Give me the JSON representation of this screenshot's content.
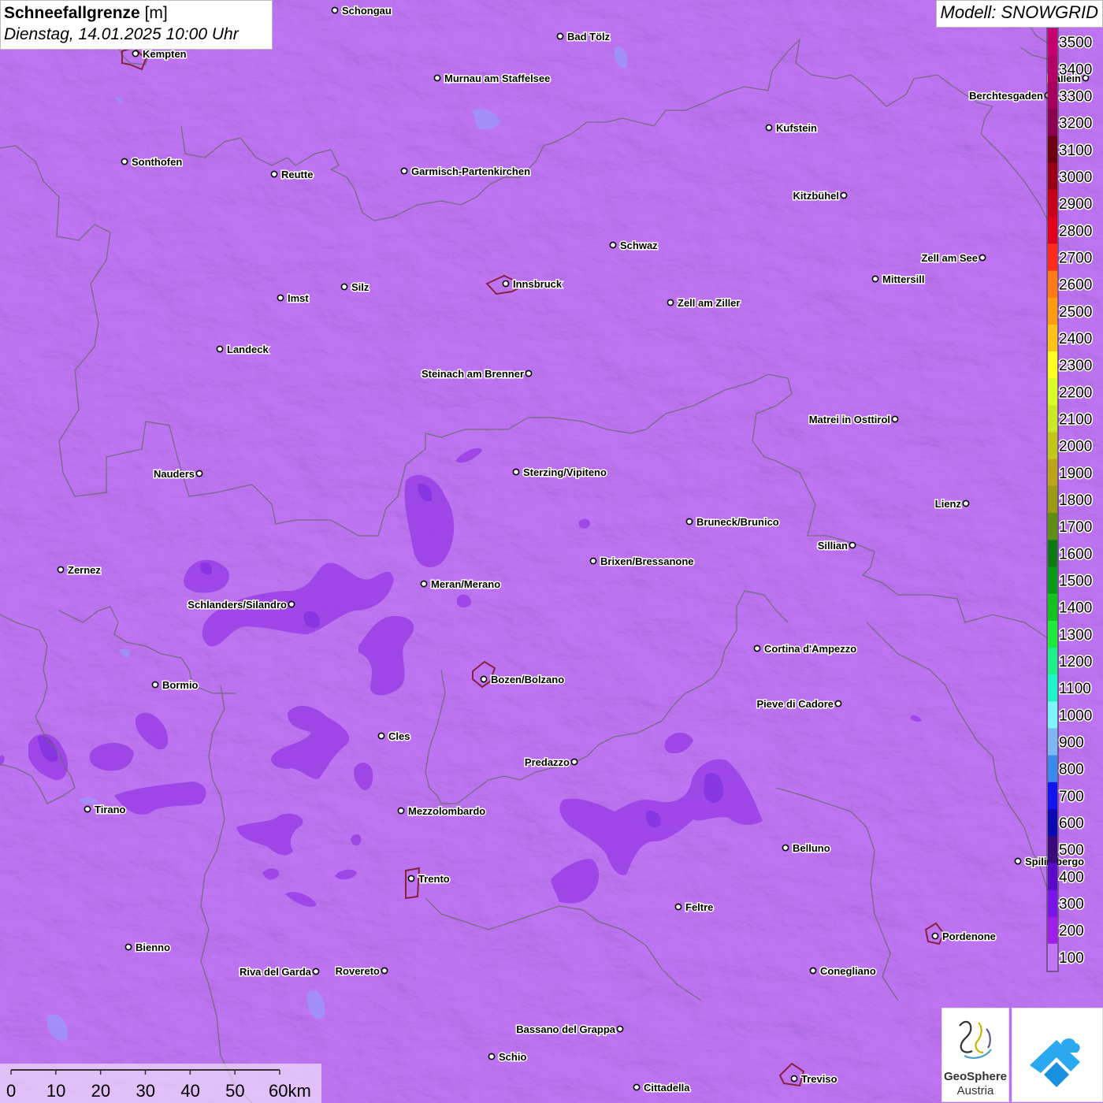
{
  "header": {
    "title_bold": "Schneefallgrenze",
    "title_unit": "[m]",
    "datetime": "Dienstag, 14.01.2025 10:00 Uhr",
    "model": "Modell: SNOWGRID"
  },
  "colors": {
    "background": "#c277f7",
    "snow_zone_dark": "#9a3fe6",
    "snow_zone_core": "#7b2be0",
    "border_line": "#666666",
    "city_outline": "#8a2040"
  },
  "legend": {
    "levels": [
      {
        "label": "3500",
        "color": "#c6006f"
      },
      {
        "label": "3400",
        "color": "#b40066"
      },
      {
        "label": "3300",
        "color": "#a5005f"
      },
      {
        "label": "3200",
        "color": "#8b0050"
      },
      {
        "label": "3100",
        "color": "#6e0014"
      },
      {
        "label": "3000",
        "color": "#9b0014"
      },
      {
        "label": "2900",
        "color": "#c8001a"
      },
      {
        "label": "2800",
        "color": "#e0001c"
      },
      {
        "label": "2700",
        "color": "#ff2a1c"
      },
      {
        "label": "2600",
        "color": "#ff7a14"
      },
      {
        "label": "2500",
        "color": "#ff9a12"
      },
      {
        "label": "2400",
        "color": "#ffc21a"
      },
      {
        "label": "2300",
        "color": "#ffff22"
      },
      {
        "label": "2200",
        "color": "#d9ff25"
      },
      {
        "label": "2100",
        "color": "#c8e828"
      },
      {
        "label": "2000",
        "color": "#c2c61a"
      },
      {
        "label": "1900",
        "color": "#bca41a"
      },
      {
        "label": "1800",
        "color": "#9a9a14"
      },
      {
        "label": "1700",
        "color": "#5e8e14"
      },
      {
        "label": "1600",
        "color": "#0b7a14"
      },
      {
        "label": "1500",
        "color": "#0a9a1a"
      },
      {
        "label": "1400",
        "color": "#14c41e"
      },
      {
        "label": "1300",
        "color": "#1ee83a"
      },
      {
        "label": "1200",
        "color": "#1ef08c"
      },
      {
        "label": "1100",
        "color": "#22f2c8"
      },
      {
        "label": "1000",
        "color": "#7ef6f8"
      },
      {
        "label": "900",
        "color": "#7eb6f6"
      },
      {
        "label": "800",
        "color": "#3a8aee"
      },
      {
        "label": "700",
        "color": "#1414ee"
      },
      {
        "label": "600",
        "color": "#0a0ab4"
      },
      {
        "label": "500",
        "color": "#3a0a7a"
      },
      {
        "label": "400",
        "color": "#5a0ac8"
      },
      {
        "label": "300",
        "color": "#7a14e8"
      },
      {
        "label": "200",
        "color": "#a01ee8"
      },
      {
        "label": "100",
        "color": "#c277f7"
      }
    ]
  },
  "cities": [
    {
      "name": "Schongau"
    },
    {
      "name": "Bad Tölz"
    },
    {
      "name": "Kempten"
    },
    {
      "name": "Murnau am Staffelsee"
    },
    {
      "name": "Berchtesgaden"
    },
    {
      "name": "Hallein"
    },
    {
      "name": "Kufstein"
    },
    {
      "name": "Sonthofen"
    },
    {
      "name": "Reutte"
    },
    {
      "name": "Garmisch-Partenkirchen"
    },
    {
      "name": "Kitzbühel"
    },
    {
      "name": "Schwaz"
    },
    {
      "name": "Zell am See"
    },
    {
      "name": "Mittersill"
    },
    {
      "name": "Innsbruck"
    },
    {
      "name": "Silz"
    },
    {
      "name": "Imst"
    },
    {
      "name": "Zell am Ziller"
    },
    {
      "name": "Landeck"
    },
    {
      "name": "Steinach am Brenner"
    },
    {
      "name": "Matrei in Osttirol"
    },
    {
      "name": "Nauders"
    },
    {
      "name": "Sterzing/Vipiteno"
    },
    {
      "name": "Lienz"
    },
    {
      "name": "Bruneck/Brunico"
    },
    {
      "name": "Sillian"
    },
    {
      "name": "Brixen/Bressanone"
    },
    {
      "name": "Zernez"
    },
    {
      "name": "Meran/Merano"
    },
    {
      "name": "Schlanders/Silandro"
    },
    {
      "name": "Cortina d'Ampezzo"
    },
    {
      "name": "Bozen/Bolzano"
    },
    {
      "name": "Bormio"
    },
    {
      "name": "Pieve di Cadore"
    },
    {
      "name": "Cles"
    },
    {
      "name": "Predazzo"
    },
    {
      "name": "Tirano"
    },
    {
      "name": "Mezzolombardo"
    },
    {
      "name": "Belluno"
    },
    {
      "name": "Spilimbergo"
    },
    {
      "name": "Trento"
    },
    {
      "name": "Feltre"
    },
    {
      "name": "Pordenone"
    },
    {
      "name": "Bienno"
    },
    {
      "name": "Riva del Garda"
    },
    {
      "name": "Rovereto"
    },
    {
      "name": "Conegliano"
    },
    {
      "name": "Bassano del Grappa"
    },
    {
      "name": "Schio"
    },
    {
      "name": "Treviso"
    },
    {
      "name": "Cittadella"
    }
  ],
  "scale_bar": {
    "ticks": [
      "0",
      "10",
      "20",
      "30",
      "40",
      "50",
      "60km"
    ]
  },
  "logos": {
    "geosphere_line1": "GeoSphere",
    "geosphere_line2": "Austria"
  }
}
